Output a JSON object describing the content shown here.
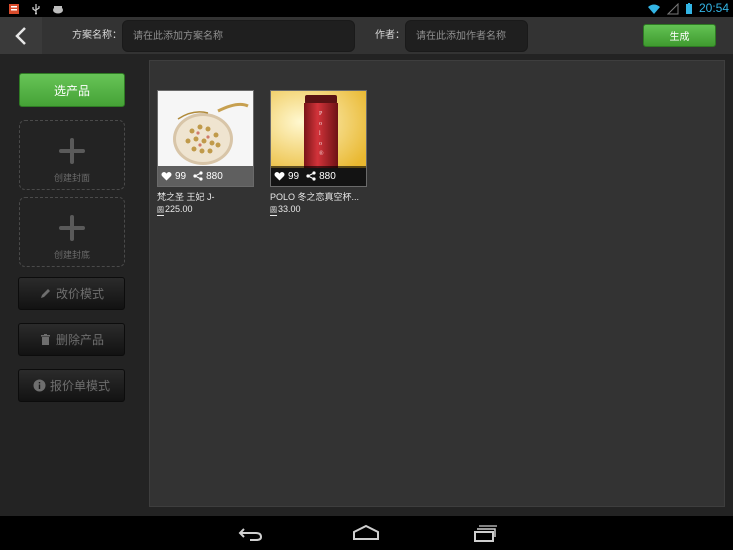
{
  "status_bar": {
    "time": "20:54",
    "left_icons": [
      "app-notification-icon",
      "usb-icon",
      "android-debug-icon"
    ],
    "right_icons": [
      "wifi-icon",
      "signal-icon",
      "battery-icon"
    ]
  },
  "toolbar": {
    "plan_label": "方案名称：",
    "plan_placeholder": "请在此添加方案名称",
    "plan_value": "",
    "author_label": "作者：",
    "author_placeholder": "请在此添加作者名称",
    "author_value": "",
    "generate_label": "生成"
  },
  "sidebar": {
    "select_products_label": "选产品",
    "create_cover_label": "创建封面",
    "create_back_cover_label": "创建封底",
    "edit_price_label": "改价模式",
    "delete_product_label": "删除产品",
    "quote_mode_label": "报价单模式"
  },
  "products": [
    {
      "name": "梵之圣 王妃 J-",
      "likes": "99",
      "shares": "880",
      "currency": "圆",
      "price": "225.00",
      "image": "compact-mirror-product-image"
    },
    {
      "name": "POLO 冬之恋真空杯...",
      "likes": "99",
      "shares": "880",
      "currency": "圆",
      "price": "33.00",
      "image": "red-vacuum-cup-product-image"
    }
  ],
  "nav_bar": {
    "icons": [
      "back-icon",
      "home-icon",
      "recent-apps-icon"
    ]
  },
  "colors": {
    "status_accent": "#33b5e5",
    "green_button": "#4ea83e",
    "canvas_bg": "#333333",
    "sidebar_bg": "#232323"
  }
}
